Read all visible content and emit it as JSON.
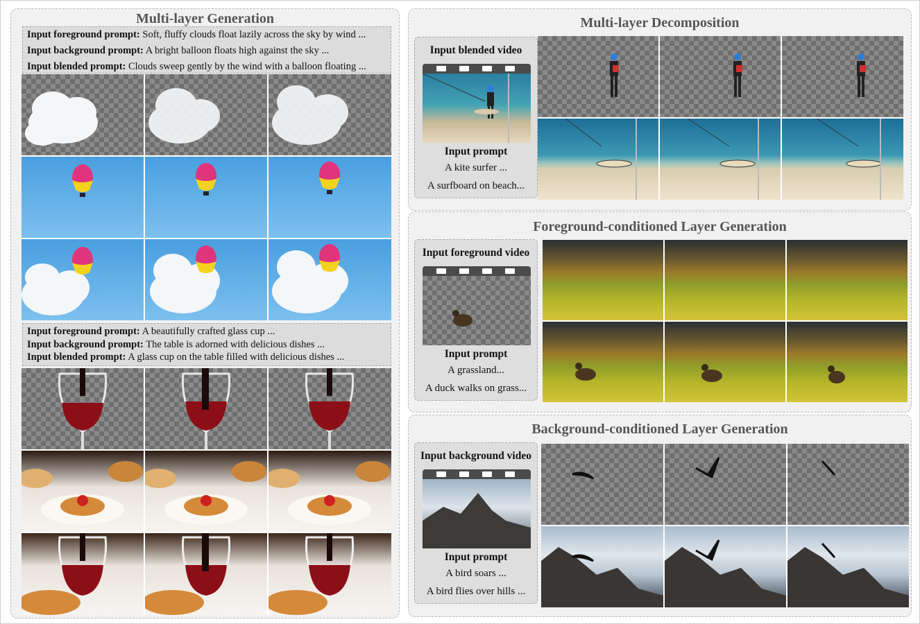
{
  "left": {
    "title": "Multi-layer Generation",
    "set1": [
      {
        "label": "Input foreground prompt:",
        "text": "Soft, fluffy clouds float lazily across the sky by wind ..."
      },
      {
        "label": "Input background prompt:",
        "text": "A bright balloon floats high against the sky ..."
      },
      {
        "label": "Input blended prompt:",
        "text": "Clouds sweep gently by the wind with a balloon floating ..."
      }
    ],
    "set2": [
      {
        "label": "Input foreground prompt:",
        "text": "A beautifully crafted glass cup ..."
      },
      {
        "label": "Input background prompt:",
        "text": "The table is adorned with delicious dishes ..."
      },
      {
        "label": "Input blended prompt:",
        "text": "A glass cup on the table filled with delicious dishes ..."
      }
    ]
  },
  "decomposition": {
    "title": "Multi-layer Decomposition",
    "input_label": "Input blended video",
    "prompt_label": "Input prompt",
    "prompt1": "A kite surfer ...",
    "prompt2": "A surfboard on beach..."
  },
  "foreground": {
    "title": "Foreground-conditioned Layer Generation",
    "input_label": "Input foreground video",
    "prompt_label": "Input prompt",
    "prompt1": "A grassland...",
    "prompt2": "A duck walks on grass..."
  },
  "background": {
    "title": "Background-conditioned Layer Generation",
    "input_label": "Input background video",
    "prompt_label": "Input prompt",
    "prompt1": "A bird soars ...",
    "prompt2": "A bird flies over hills ..."
  }
}
